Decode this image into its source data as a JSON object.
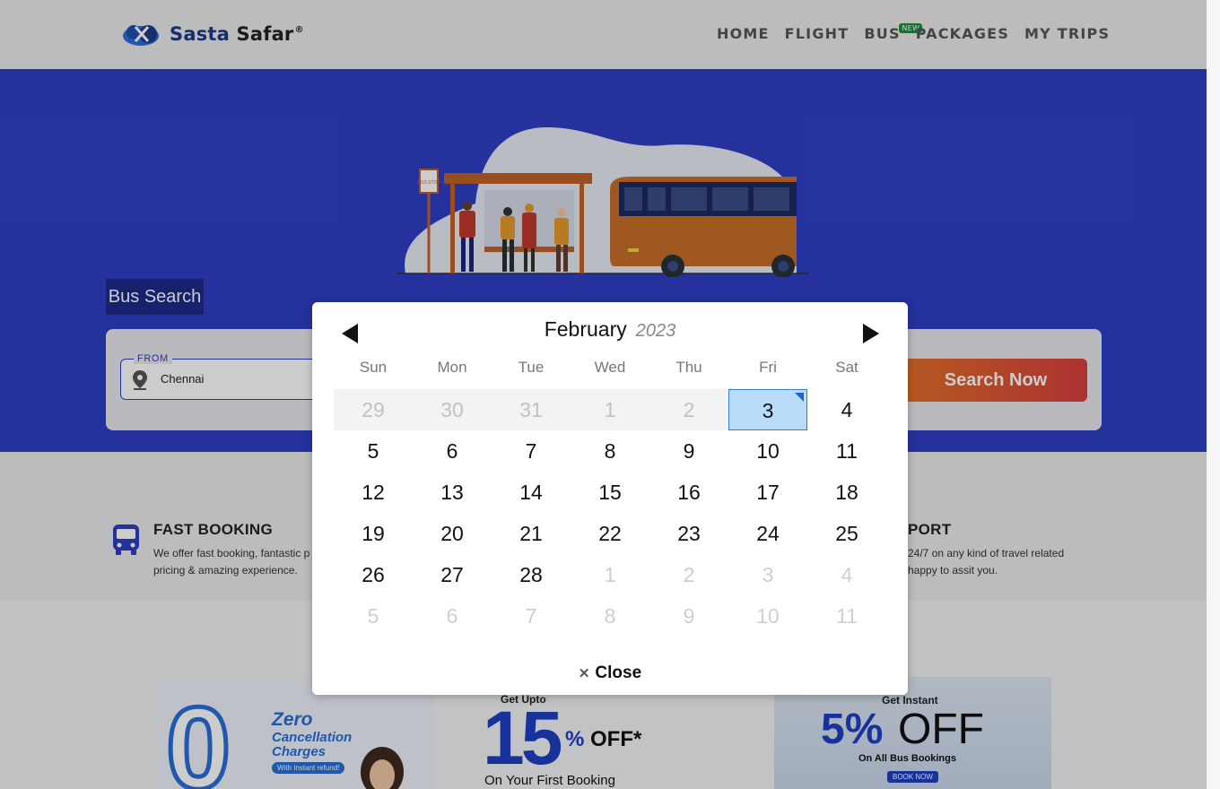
{
  "header": {
    "logo": {
      "brand_first": "Sasta",
      "brand_second": "Safar",
      "reg": "®"
    },
    "nav": [
      {
        "label": "HOME",
        "badge": ""
      },
      {
        "label": "FLIGHT",
        "badge": ""
      },
      {
        "label": "BUS",
        "badge": "NEW"
      },
      {
        "label": "PACKAGES",
        "badge": ""
      },
      {
        "label": "MY TRIPS",
        "badge": ""
      }
    ]
  },
  "hero": {
    "tab_label": "Bus Search",
    "bus_stop_sign": "BUS STOP"
  },
  "search": {
    "from_label": "FROM",
    "from_value": "Chennai",
    "button_label": "Search Now"
  },
  "features": [
    {
      "icon": "bus-icon",
      "title": "FAST BOOKING",
      "desc": "We offer fast booking, fantastic p pricing & amazing experience."
    },
    {
      "title": "PORT",
      "desc": "24/7 on any kind of travel related happy to assit you."
    }
  ],
  "promos": {
    "p1": {
      "big": "0",
      "line1": "Zero",
      "line2": "Cancellation",
      "line3": "Charges",
      "tag": "With Instant refund!"
    },
    "p2": {
      "top": "Get Upto",
      "big": "15",
      "pct": "%",
      "off": "OFF*",
      "bottom": "On Your First Booking"
    },
    "p3": {
      "top": "Get Instant",
      "big": "5%",
      "off": "OFF",
      "line": "On All Bus Bookings",
      "btn": "BOOK NOW"
    }
  },
  "calendar": {
    "month": "February",
    "year": "2023",
    "weekdays": [
      "Sun",
      "Mon",
      "Tue",
      "Wed",
      "Thu",
      "Fri",
      "Sat"
    ],
    "weeks": [
      [
        {
          "d": "29",
          "s": "past"
        },
        {
          "d": "30",
          "s": "past"
        },
        {
          "d": "31",
          "s": "past"
        },
        {
          "d": "1",
          "s": "past"
        },
        {
          "d": "2",
          "s": "past"
        },
        {
          "d": "3",
          "s": "today"
        },
        {
          "d": "4",
          "s": ""
        }
      ],
      [
        {
          "d": "5",
          "s": ""
        },
        {
          "d": "6",
          "s": ""
        },
        {
          "d": "7",
          "s": ""
        },
        {
          "d": "8",
          "s": ""
        },
        {
          "d": "9",
          "s": ""
        },
        {
          "d": "10",
          "s": ""
        },
        {
          "d": "11",
          "s": ""
        }
      ],
      [
        {
          "d": "12",
          "s": ""
        },
        {
          "d": "13",
          "s": ""
        },
        {
          "d": "14",
          "s": ""
        },
        {
          "d": "15",
          "s": ""
        },
        {
          "d": "16",
          "s": ""
        },
        {
          "d": "17",
          "s": ""
        },
        {
          "d": "18",
          "s": ""
        }
      ],
      [
        {
          "d": "19",
          "s": ""
        },
        {
          "d": "20",
          "s": ""
        },
        {
          "d": "21",
          "s": ""
        },
        {
          "d": "22",
          "s": ""
        },
        {
          "d": "23",
          "s": ""
        },
        {
          "d": "24",
          "s": ""
        },
        {
          "d": "25",
          "s": ""
        }
      ],
      [
        {
          "d": "26",
          "s": ""
        },
        {
          "d": "27",
          "s": ""
        },
        {
          "d": "28",
          "s": ""
        },
        {
          "d": "1",
          "s": "other"
        },
        {
          "d": "2",
          "s": "other"
        },
        {
          "d": "3",
          "s": "other"
        },
        {
          "d": "4",
          "s": "other"
        }
      ],
      [
        {
          "d": "5",
          "s": "other"
        },
        {
          "d": "6",
          "s": "other"
        },
        {
          "d": "7",
          "s": "other"
        },
        {
          "d": "8",
          "s": "other"
        },
        {
          "d": "9",
          "s": "other"
        },
        {
          "d": "10",
          "s": "other"
        },
        {
          "d": "11",
          "s": "other"
        }
      ]
    ],
    "close_label": "Close"
  },
  "colors": {
    "hero": "#2f3ec4",
    "brand": "#1d3a8a",
    "today": "#b9dcfa",
    "search_button": "#e2702a"
  }
}
